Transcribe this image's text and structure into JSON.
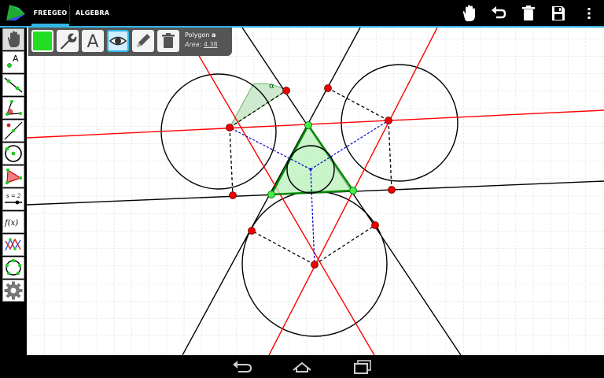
{
  "tabs": [
    {
      "label": "FREEGEO",
      "selected": true
    },
    {
      "label": "ALGEBRA",
      "selected": false
    }
  ],
  "actions": [
    "hand-icon",
    "undo-icon",
    "delete-icon",
    "save-icon",
    "overflow-menu-icon"
  ],
  "tools": [
    {
      "name": "move-tool",
      "icon": "hand-icon",
      "selected": true
    },
    {
      "name": "point-tool",
      "icon": "point-icon",
      "label": "A"
    },
    {
      "name": "line-tool",
      "icon": "line-icon"
    },
    {
      "name": "angle-tool",
      "icon": "angle-icon"
    },
    {
      "name": "perpendicular-tool",
      "icon": "perpendicular-icon"
    },
    {
      "name": "circle-tool",
      "icon": "circle-icon"
    },
    {
      "name": "polygon-tool",
      "icon": "polygon-icon"
    },
    {
      "name": "slider-tool",
      "icon": "slider-icon",
      "label": "s = 2"
    },
    {
      "name": "function-tool",
      "icon": "function-icon",
      "label": "f(x)"
    },
    {
      "name": "graph-tool",
      "icon": "graph-icon"
    },
    {
      "name": "locus-tool",
      "icon": "locus-icon"
    },
    {
      "name": "settings-tool",
      "icon": "gear-icon"
    }
  ],
  "context": {
    "object_type": "Polygon",
    "object_name": "a",
    "area_label": "Area:",
    "area_value": "4.38",
    "color": "#22dd22",
    "buttons": [
      "color-swatch",
      "wrench-icon",
      "text-icon",
      "eye-icon",
      "pencil-icon",
      "trash-icon"
    ],
    "text_button_label": "A"
  },
  "canvas": {
    "angle_label": "α",
    "colors": {
      "grid": "#d9d9d9",
      "construction_red": "#ff0000",
      "triangle_fill": "#b8f0b8",
      "point_red": "#ee0000",
      "point_green": "#44ee44",
      "dashed_blue": "#0000cc"
    }
  },
  "nav": [
    "back-icon",
    "home-icon",
    "recents-icon"
  ]
}
